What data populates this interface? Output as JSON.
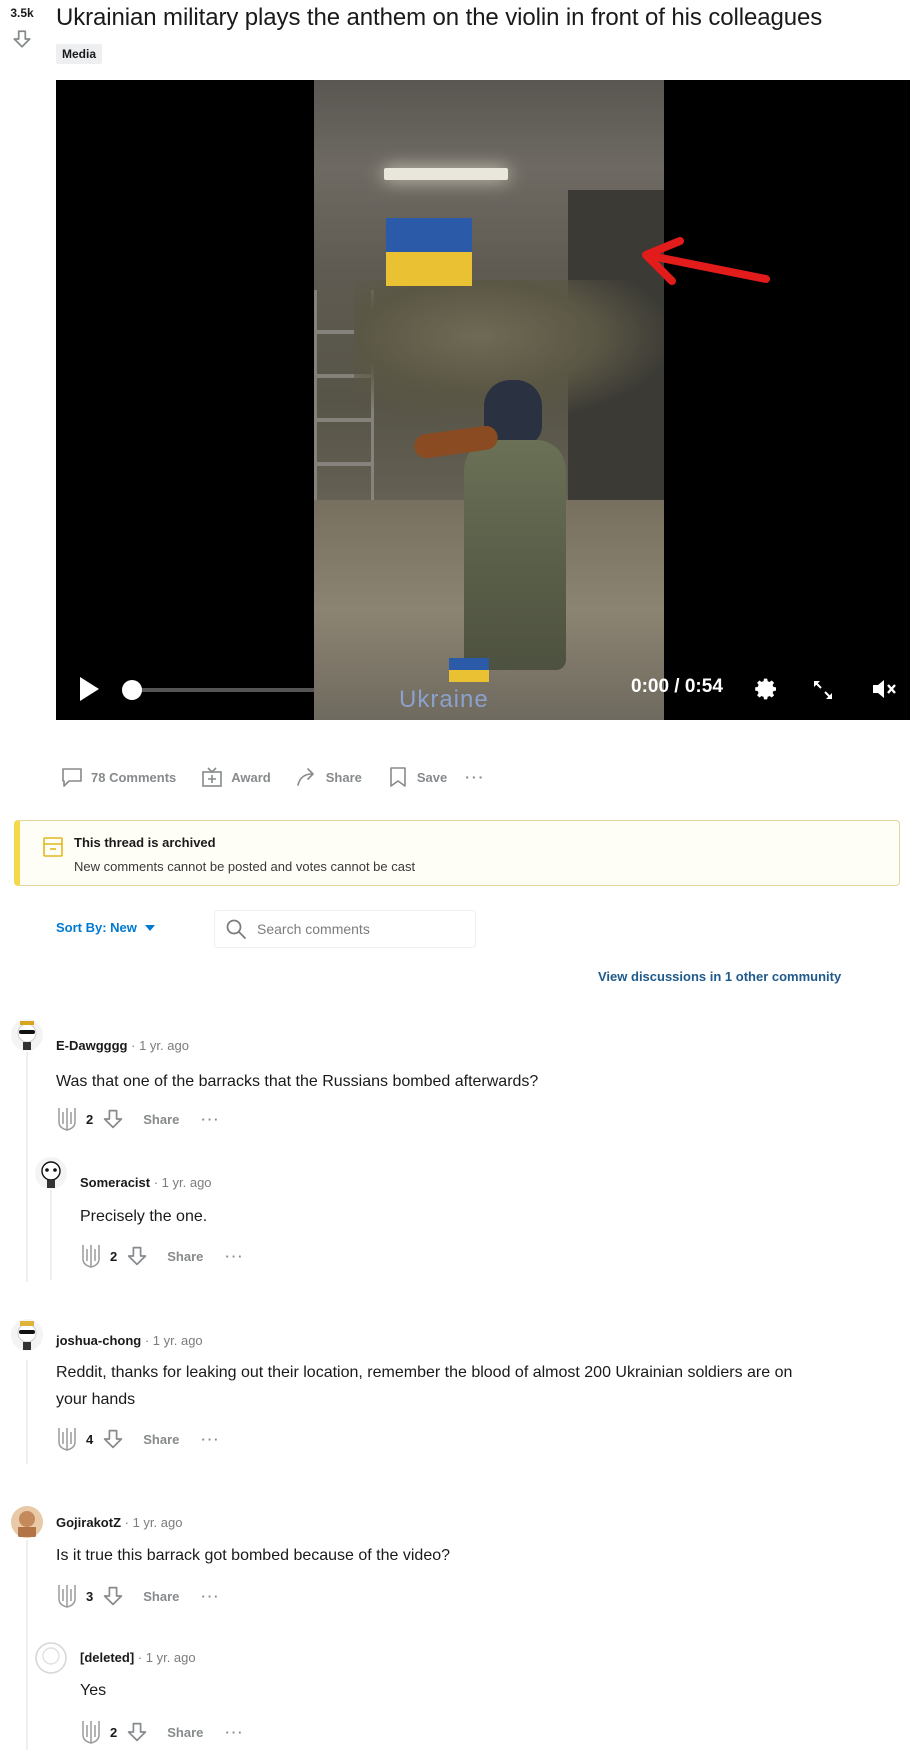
{
  "post": {
    "score": "3.5k",
    "title": "Ukrainian military plays the anthem on the violin in front of his colleagues",
    "flair": "Media"
  },
  "video": {
    "watermark": "Ukraine",
    "timecode": "0:00 / 0:54",
    "progress": 0.0
  },
  "action_bar": {
    "comments": "78 Comments",
    "award": "Award",
    "share": "Share",
    "save": "Save",
    "more": "···"
  },
  "archived": {
    "title": "This thread is archived",
    "message": "New comments cannot be posted and votes cannot be cast"
  },
  "sort": {
    "label": "Sort By: New"
  },
  "search": {
    "placeholder": "Search comments"
  },
  "view_discussions": "View discussions in 1 other community",
  "comments": [
    {
      "author": "E-Dawgggg",
      "time": "· 1 yr. ago",
      "body": "Was that one of the barracks that the Russians bombed afterwards?",
      "score": "2",
      "share": "Share",
      "more": "···"
    },
    {
      "author": "Someracist",
      "time": "· 1 yr. ago",
      "body": "Precisely the one.",
      "score": "2",
      "share": "Share",
      "more": "···"
    },
    {
      "author": "joshua-chong",
      "time": "· 1 yr. ago",
      "body": "Reddit, thanks for leaking out their location, remember the blood of almost 200 Ukrainian soldiers are on your hands",
      "score": "4",
      "share": "Share",
      "more": "···"
    },
    {
      "author": "GojirakotZ",
      "time": "· 1 yr. ago",
      "body": "Is it true this barrack got bombed because of the video?",
      "score": "3",
      "share": "Share",
      "more": "···"
    },
    {
      "author": "[deleted]",
      "time": "· 1 yr. ago",
      "body": "Yes",
      "score": "2",
      "share": "Share",
      "more": "···"
    }
  ],
  "colors": {
    "link_blue": "#0079d3",
    "archived_accent": "#f5d94c",
    "arrow_red": "#e21b1b",
    "flag_blue": "#2b5aa8",
    "flag_yellow": "#e9c132"
  }
}
